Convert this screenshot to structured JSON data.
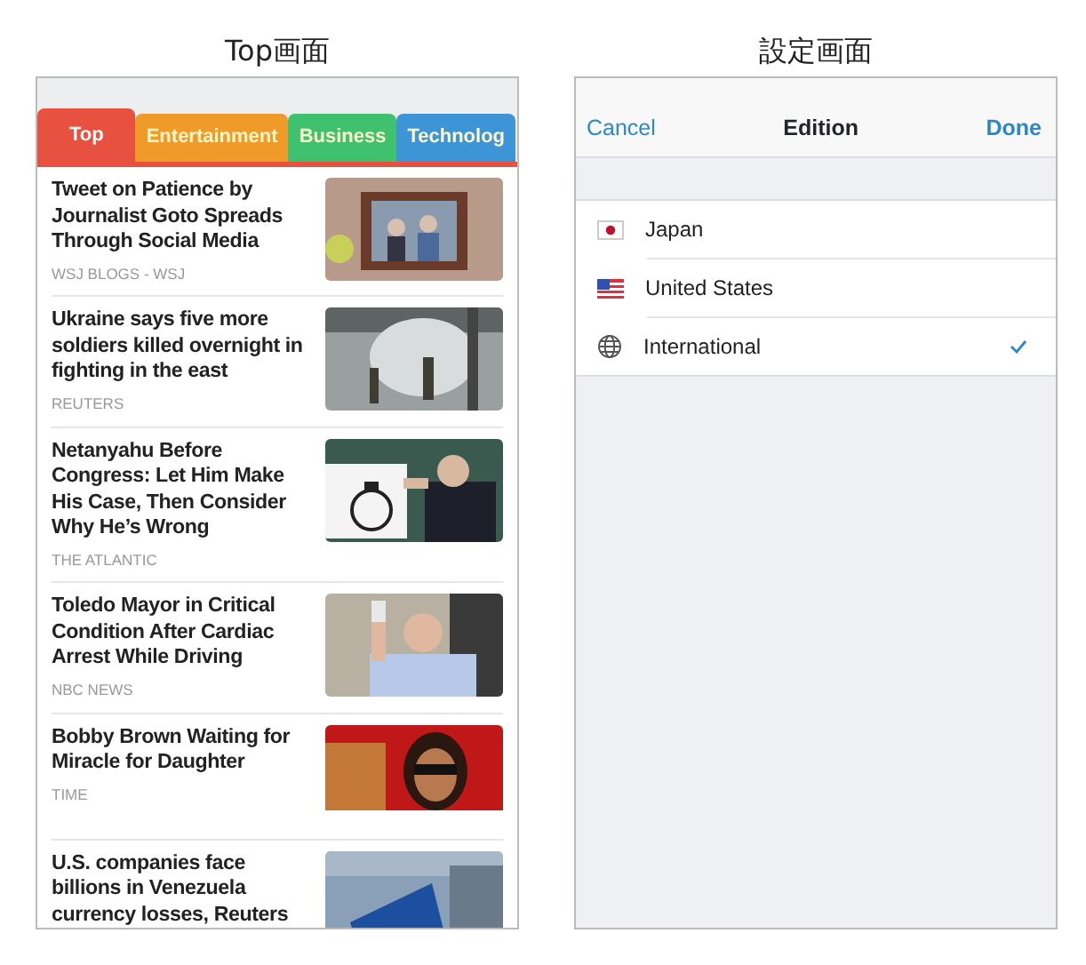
{
  "captions": [
    "Top画面",
    "設定画面"
  ],
  "news": {
    "tabs": [
      {
        "label": "Top",
        "selected": true,
        "color": "#e8503f"
      },
      {
        "label": "Entertainment",
        "selected": false,
        "color": "#f09a2a"
      },
      {
        "label": "Business",
        "selected": false,
        "color": "#3fc170"
      },
      {
        "label": "Technolog",
        "selected": false,
        "color": "#3d95d8"
      }
    ],
    "articles": [
      {
        "title": "Tweet on Patience by Journalist Goto Spreads Through Social Media",
        "source": "WSJ BLOGS - WSJ"
      },
      {
        "title": "Ukraine says five more soldiers killed overnight in fighting in the east",
        "source": "REUTERS"
      },
      {
        "title": "Netanyahu Before Congress: Let Him Make His Case, Then Consider Why He’s Wrong",
        "source": "THE ATLANTIC"
      },
      {
        "title": "Toledo Mayor in Critical Condition After Cardiac Arrest While Driving",
        "source": "NBC NEWS"
      },
      {
        "title": "Bobby Brown Waiting for Miracle for Daughter",
        "source": "TIME"
      },
      {
        "title": "U.S. companies face billions in Venezuela currency losses, Reuters"
      }
    ]
  },
  "settings": {
    "cancel": "Cancel",
    "title": "Edition",
    "done": "Done",
    "editions": [
      {
        "label": "Japan",
        "kind": "japan",
        "selected": false
      },
      {
        "label": "United States",
        "kind": "usa",
        "selected": false
      },
      {
        "label": "International",
        "kind": "globe",
        "selected": true
      }
    ]
  }
}
